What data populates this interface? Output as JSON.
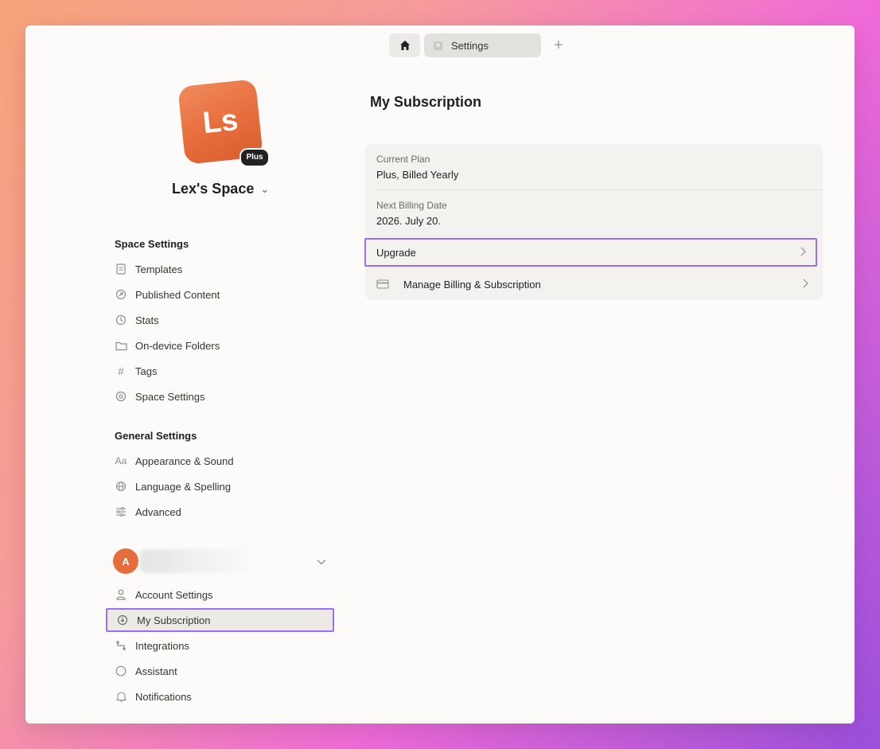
{
  "tabs": {
    "home_icon": "home-icon",
    "settings_label": "Settings",
    "new_tab_label": "+"
  },
  "space": {
    "logo_text": "Ls",
    "badge": "Plus",
    "name": "Lex's Space"
  },
  "sidebar": {
    "space_settings_title": "Space Settings",
    "space_items": [
      {
        "label": "Templates",
        "icon": "template-icon"
      },
      {
        "label": "Published Content",
        "icon": "published-icon"
      },
      {
        "label": "Stats",
        "icon": "stats-icon"
      },
      {
        "label": "On-device Folders",
        "icon": "folder-icon"
      },
      {
        "label": "Tags",
        "icon": "hash-icon"
      },
      {
        "label": "Space Settings",
        "icon": "gear-icon"
      }
    ],
    "general_settings_title": "General Settings",
    "general_items": [
      {
        "label": "Appearance & Sound",
        "icon": "font-icon"
      },
      {
        "label": "Language & Spelling",
        "icon": "globe-icon"
      },
      {
        "label": "Advanced",
        "icon": "sliders-icon"
      }
    ],
    "account": {
      "avatar_letter": "A"
    },
    "account_items": [
      {
        "label": "Account Settings",
        "icon": "person-icon"
      },
      {
        "label": "My Subscription",
        "icon": "subscription-icon",
        "active": true
      },
      {
        "label": "Integrations",
        "icon": "integrations-icon"
      },
      {
        "label": "Assistant",
        "icon": "assistant-icon"
      },
      {
        "label": "Notifications",
        "icon": "bell-icon"
      }
    ]
  },
  "main": {
    "title": "My Subscription",
    "current_plan_label": "Current Plan",
    "current_plan_value": "Plus, Billed Yearly",
    "next_billing_label": "Next Billing Date",
    "next_billing_value": "2026. July 20.",
    "upgrade_label": "Upgrade",
    "manage_label": "Manage Billing & Subscription"
  },
  "colors": {
    "accent": "#9b6df3",
    "brand": "#e66d3d"
  }
}
